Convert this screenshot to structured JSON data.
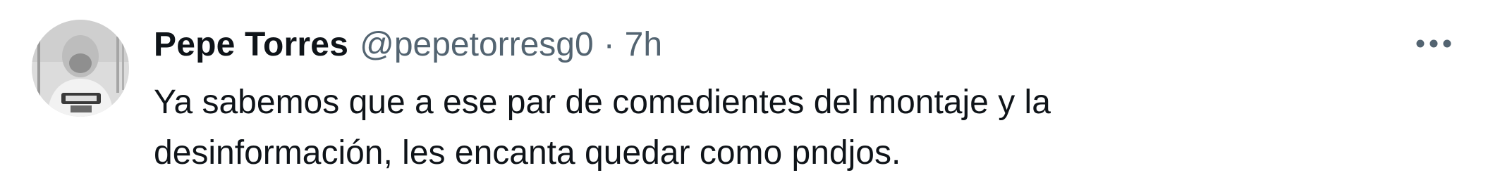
{
  "tweet": {
    "author": {
      "display_name": "Pepe Torres",
      "handle": "@pepetorresg0"
    },
    "separator": "·",
    "time": "7h",
    "text_lines": [
      "Ya sabemos que a ese par de comedientes del montaje y la",
      "desinformación, les encanta quedar como pndjos."
    ],
    "more_icon": "more-horizontal-icon"
  }
}
